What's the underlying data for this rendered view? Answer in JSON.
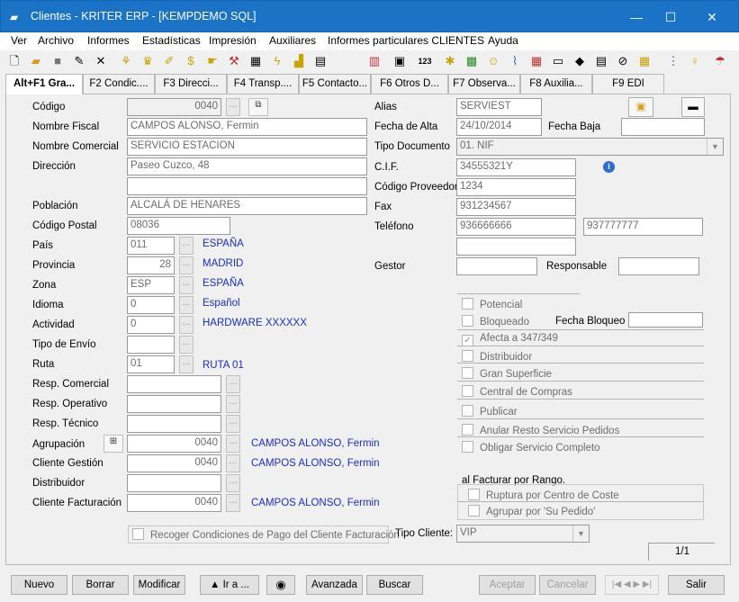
{
  "window": {
    "title": "Clientes - KRITER ERP - [KEMPDEMO SQL]",
    "minimize": "—",
    "maximize": "☐",
    "close": "✕",
    "app_icon": "folder-icon"
  },
  "menu": [
    "Ver",
    "Archivo",
    "Informes",
    "Estadísticas",
    "Impresión",
    "Auxiliares",
    "Informes particulares CLIENTES",
    "Ayuda"
  ],
  "toolbar_icons": [
    "new-document-icon",
    "open-folder-icon",
    "save-disk-icon",
    "edit-icon",
    "delete-x-icon",
    "tree-icon",
    "trophy-icon",
    "pencil-icon",
    "money-icon",
    "hand-icon",
    "brush-icon",
    "calendar-icon",
    "lightning-icon",
    "bar-chart-icon",
    "briefcase-icon",
    "table-icon",
    "numbers-icon",
    "bee-icon",
    "map-icon",
    "people-icon",
    "paperclip-icon",
    "report-icon",
    "window-icon",
    "tag-icon",
    "document-icon",
    "clip-icon",
    "grid-icon",
    "org-icon",
    "bulb-icon",
    "umbrella-icon"
  ],
  "tabs": [
    "Alt+F1 Gra...",
    "F2 Condic....",
    "F3 Direcci...",
    "F4 Transp....",
    "F5 Contacto...",
    "F6 Otros D...",
    "F7 Observa...",
    "F8 Auxilia...",
    "F9 EDI"
  ],
  "left": {
    "codigo": {
      "label": "Código",
      "value": "0040"
    },
    "nombre_fiscal": {
      "label": "Nombre Fiscal",
      "value": "CAMPOS ALONSO, Fermin"
    },
    "nombre_comercial": {
      "label": "Nombre Comercial",
      "value": "SERVICIO ESTACION"
    },
    "direccion": {
      "label": "Dirección",
      "value": "Paseo Cuzco, 48",
      "value2": ""
    },
    "poblacion": {
      "label": "Población",
      "value": "ALCALÁ DE HENARES"
    },
    "codigo_postal": {
      "label": "Código Postal",
      "value": "08036"
    },
    "pais": {
      "label": "País",
      "value": "011",
      "desc": "ESPAÑA"
    },
    "provincia": {
      "label": "Provincia",
      "value": "28",
      "desc": "MADRID"
    },
    "zona": {
      "label": "Zona",
      "value": "ESP",
      "desc": "ESPAÑA"
    },
    "idioma": {
      "label": "Idioma",
      "value": "0",
      "desc": "Español"
    },
    "actividad": {
      "label": "Actividad",
      "value": "0",
      "desc": "HARDWARE XXXXXX"
    },
    "tipo_envio": {
      "label": "Tipo de Envío",
      "value": ""
    },
    "ruta": {
      "label": "Ruta",
      "value": "01",
      "desc": "RUTA 01"
    },
    "resp_comercial": {
      "label": "Resp. Comercial",
      "value": ""
    },
    "resp_operativo": {
      "label": "Resp. Operativo",
      "value": ""
    },
    "resp_tecnico": {
      "label": "Resp. Técnico",
      "value": ""
    },
    "agrupacion": {
      "label": "Agrupación",
      "value": "0040",
      "desc": "CAMPOS ALONSO, Fermin"
    },
    "cliente_gestion": {
      "label": "Cliente Gestión",
      "value": "0040",
      "desc": "CAMPOS ALONSO, Fermin"
    },
    "distribuidor": {
      "label": "Distribuidor",
      "value": ""
    },
    "cliente_facturacion": {
      "label": "Cliente Facturación",
      "value": "0040",
      "desc": "CAMPOS ALONSO, Fermin"
    },
    "recoger": "Recoger Condiciones de Pago del Cliente Facturación"
  },
  "right": {
    "alias": {
      "label": "Alias",
      "value": "SERVIEST"
    },
    "fecha_alta": {
      "label": "Fecha de Alta",
      "value": "24/10/2014"
    },
    "fecha_baja": {
      "label": "Fecha Baja",
      "value": ""
    },
    "tipo_documento": {
      "label": "Tipo Documento",
      "value": "01. NIF"
    },
    "cif": {
      "label": "C.I.F.",
      "value": "34555321Y"
    },
    "codigo_proveedor": {
      "label": "Código Proveedor",
      "value": "1234"
    },
    "fax": {
      "label": "Fax",
      "value": "931234567"
    },
    "telefono": {
      "label": "Teléfono",
      "value": "936666666",
      "value2": "937777777",
      "value3": ""
    },
    "gestor": {
      "label": "Gestor",
      "value": ""
    },
    "responsable": {
      "label": "Responsable",
      "value": ""
    },
    "checks": [
      {
        "label": "Potencial",
        "checked": false
      },
      {
        "label": "Bloqueado",
        "checked": false
      },
      {
        "label": "Afecta a 347/349",
        "checked": true
      },
      {
        "label": "Distribuidor",
        "checked": false
      },
      {
        "label": "Gran Superficie",
        "checked": false
      },
      {
        "label": "Central de Compras",
        "checked": false
      },
      {
        "label": "Publicar",
        "checked": false
      },
      {
        "label": "Anular Resto Servicio Pedidos",
        "checked": false
      },
      {
        "label": "Obligar Servicio Completo",
        "checked": false
      }
    ],
    "fecha_bloqueo": {
      "label": "Fecha Bloqueo",
      "value": ""
    },
    "rango": {
      "title": "al Facturar por Rango.",
      "ruptura": "Ruptura por Centro de Coste",
      "agrupar": "Agrupar por 'Su Pedido'"
    },
    "tipo_cliente": {
      "label": "Tipo Cliente:",
      "value": "VIP"
    },
    "record": "1/1"
  },
  "buttons": {
    "nuevo": "Nuevo",
    "borrar": "Borrar",
    "modificar": "Modificar",
    "ir_a": "▲ Ir a ...",
    "avanzada": "Avanzada",
    "buscar": "Buscar",
    "aceptar": "Aceptar",
    "cancelar": "Cancelar",
    "salir": "Salir"
  }
}
